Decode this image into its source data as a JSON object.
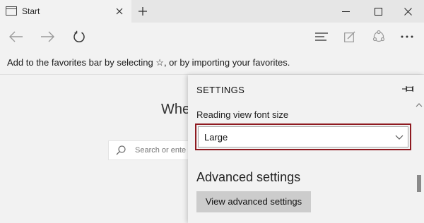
{
  "tab": {
    "title": "Start"
  },
  "favorites_bar": {
    "message": "Add to the favorites bar by selecting ☆, or by importing your favorites."
  },
  "start_page": {
    "heading_partial": "Whe",
    "search_placeholder_partial": "Search or ente"
  },
  "settings": {
    "title": "SETTINGS",
    "font_size_label": "Reading view font size",
    "font_size_value": "Large",
    "advanced_heading": "Advanced settings",
    "advanced_button": "View advanced settings"
  },
  "colors": {
    "highlight_outline": "#8e1a20",
    "button_bg": "#cccccc",
    "chrome_bg": "#f2f2f2"
  }
}
